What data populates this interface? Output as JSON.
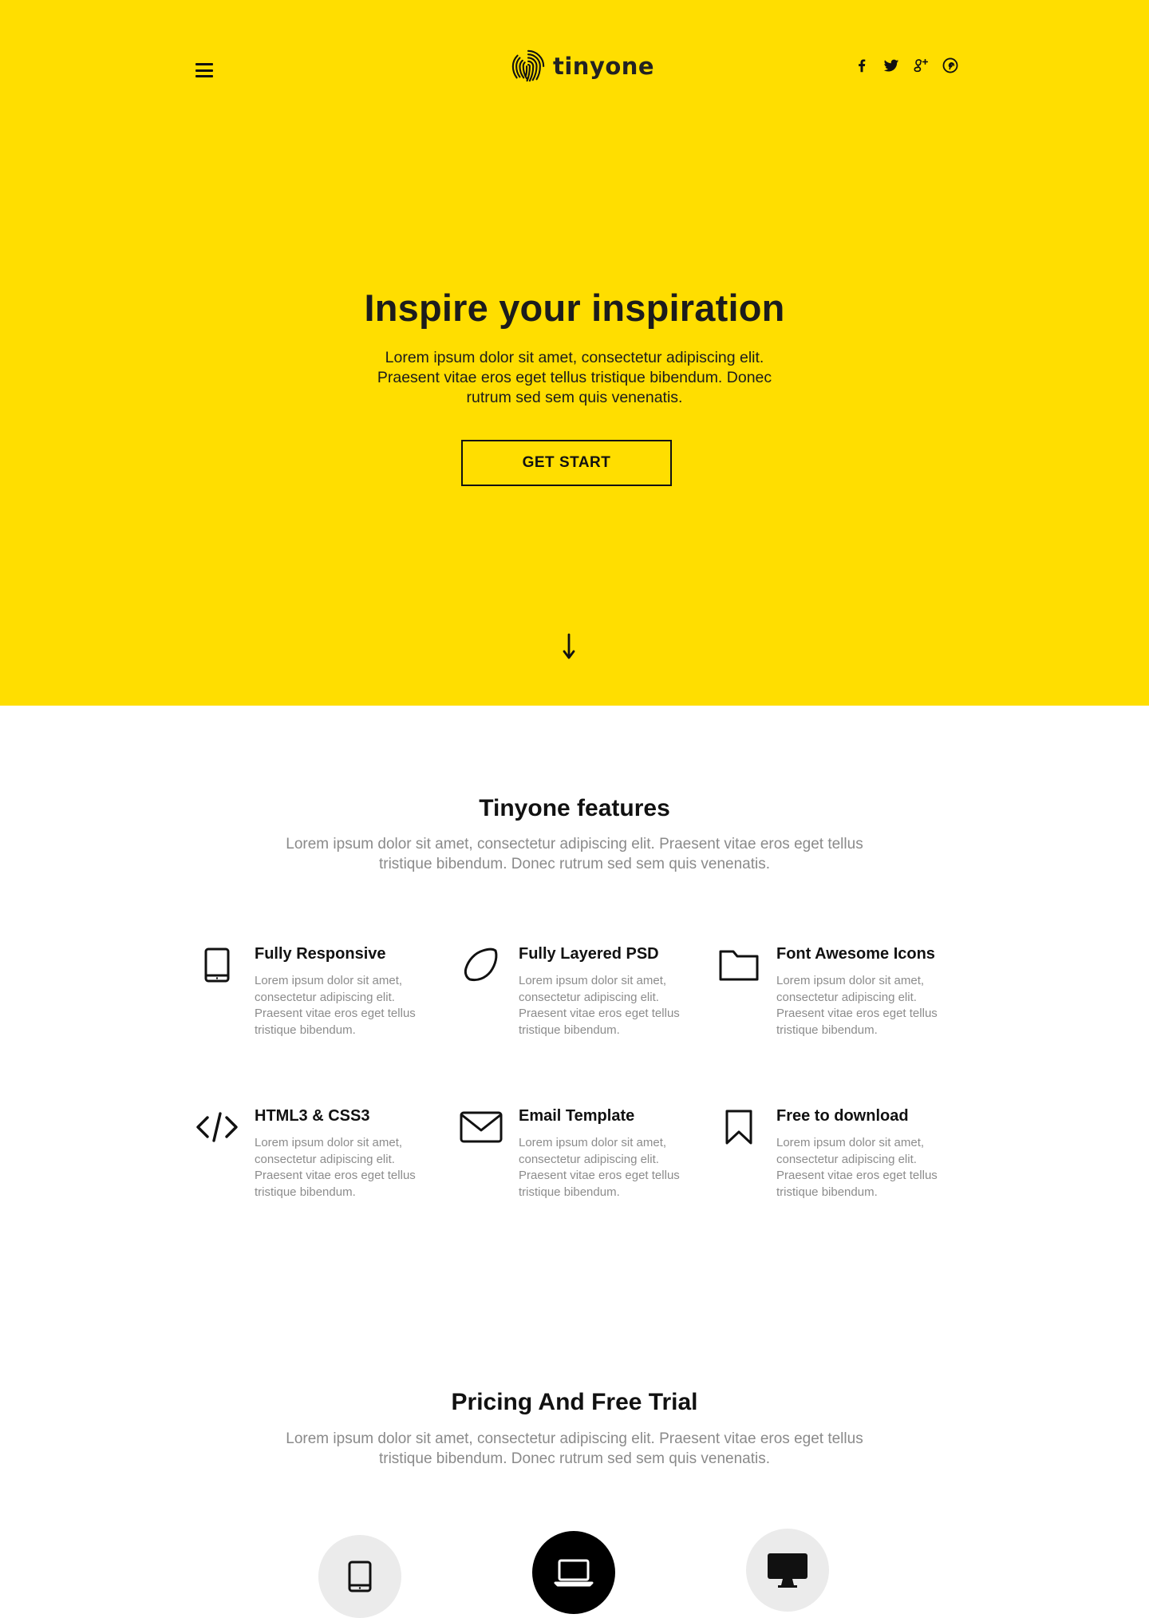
{
  "colors": {
    "hero_background": "#ffde00",
    "text_dark": "#111111",
    "text_muted": "#8a8a8a",
    "device_circle": "#ebebeb",
    "device_circle_active": "#000000"
  },
  "header": {
    "menu_icon": "hamburger-menu-icon",
    "logo": {
      "icon": "fingerprint-icon",
      "text": "tinyone"
    },
    "socials": [
      {
        "icon": "facebook-icon"
      },
      {
        "icon": "twitter-icon"
      },
      {
        "icon": "google-plus-icon"
      },
      {
        "icon": "pinterest-icon"
      }
    ]
  },
  "hero": {
    "title": "Inspire your inspiration",
    "text": "Lorem ipsum dolor sit amet, consectetur adipiscing elit. Praesent vitae eros eget tellus tristique bibendum. Donec rutrum sed sem quis venenatis.",
    "cta_label": "GET START",
    "scroll_icon": "arrow-down-icon"
  },
  "features": {
    "title": "Tinyone features",
    "text": "Lorem ipsum dolor sit amet, consectetur adipiscing elit. Praesent vitae eros eget tellus tristique bibendum. Donec rutrum sed sem quis venenatis.",
    "items": [
      {
        "icon": "tablet-icon",
        "title": "Fully Responsive",
        "text": "Lorem ipsum dolor sit amet, consectetur adipiscing elit. Praesent vitae eros eget tellus tristique bibendum."
      },
      {
        "icon": "lemon-icon",
        "title": "Fully Layered PSD",
        "text": "Lorem ipsum dolor sit amet, consectetur adipiscing elit. Praesent vitae eros eget tellus tristique bibendum."
      },
      {
        "icon": "folder-icon",
        "title": "Font Awesome Icons",
        "text": "Lorem ipsum dolor sit amet, consectetur adipiscing elit. Praesent vitae eros eget tellus tristique bibendum."
      },
      {
        "icon": "code-icon",
        "title": "HTML3 & CSS3",
        "text": "Lorem ipsum dolor sit amet, consectetur adipiscing elit. Praesent vitae eros eget tellus tristique bibendum."
      },
      {
        "icon": "envelope-icon",
        "title": "Email Template",
        "text": "Lorem ipsum dolor sit amet, consectetur adipiscing elit. Praesent vitae eros eget tellus tristique bibendum."
      },
      {
        "icon": "bookmark-icon",
        "title": "Free to download",
        "text": "Lorem ipsum dolor sit amet, consectetur adipiscing elit. Praesent vitae eros eget tellus tristique bibendum."
      }
    ]
  },
  "pricing": {
    "title": "Pricing And Free Trial",
    "text": "Lorem ipsum dolor sit amet, consectetur adipiscing elit. Praesent vitae eros eget tellus tristique bibendum. Donec rutrum sed sem quis venenatis.",
    "devices": [
      {
        "icon": "tablet-icon",
        "active": false
      },
      {
        "icon": "laptop-icon",
        "active": true
      },
      {
        "icon": "desktop-icon",
        "active": false
      }
    ]
  }
}
